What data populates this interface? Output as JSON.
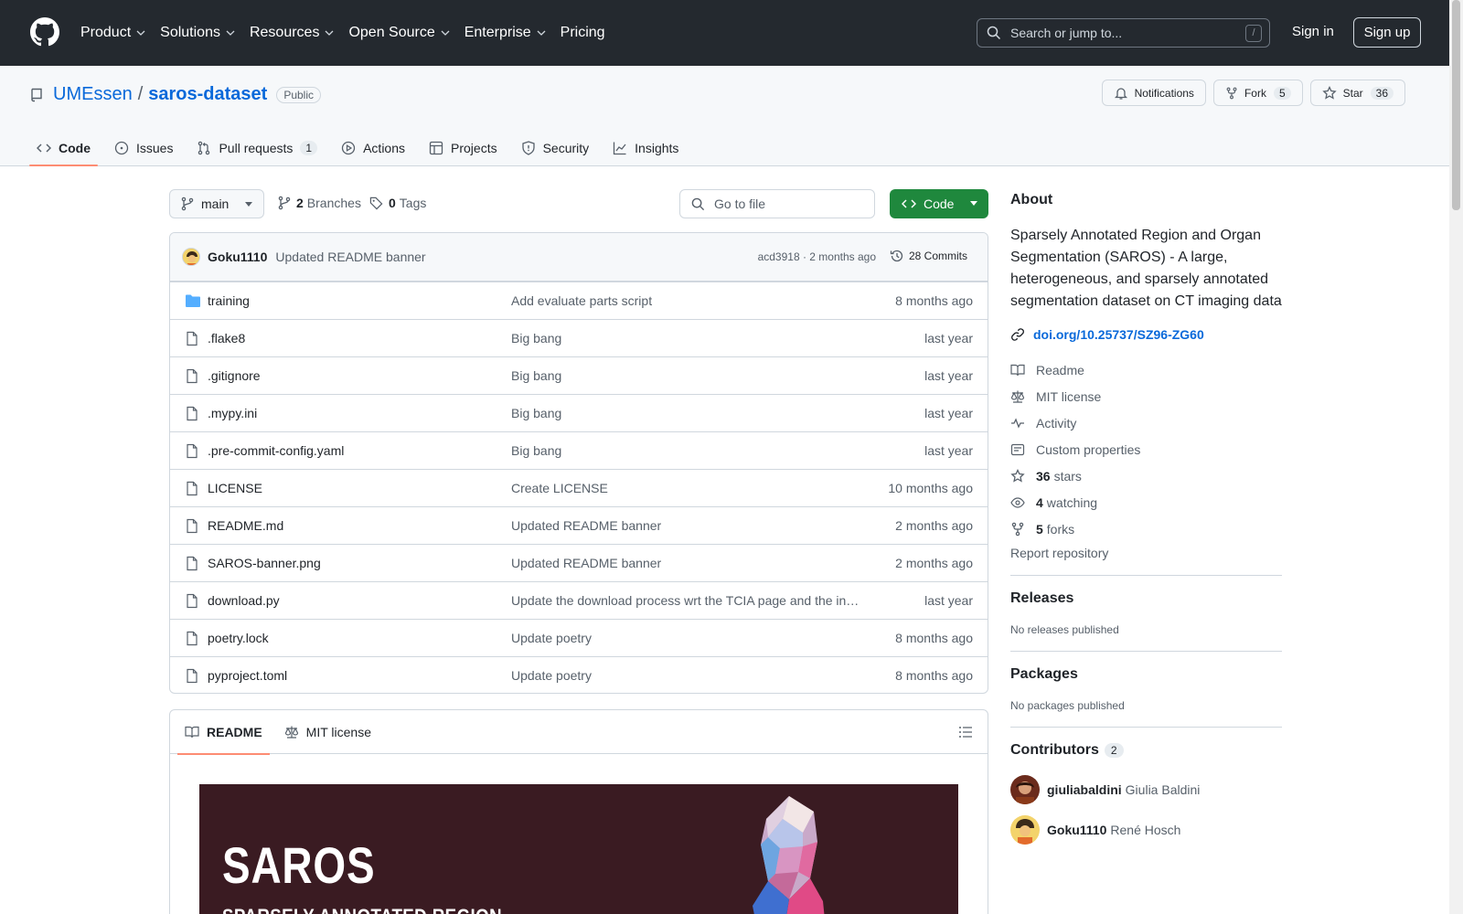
{
  "header": {
    "nav": [
      {
        "label": "Product",
        "has_menu": true
      },
      {
        "label": "Solutions",
        "has_menu": true
      },
      {
        "label": "Resources",
        "has_menu": true
      },
      {
        "label": "Open Source",
        "has_menu": true
      },
      {
        "label": "Enterprise",
        "has_menu": true
      },
      {
        "label": "Pricing",
        "has_menu": false
      }
    ],
    "search_placeholder": "Search or jump to...",
    "search_key": "/",
    "sign_in": "Sign in",
    "sign_up": "Sign up"
  },
  "repo": {
    "owner": "UMEssen",
    "separator": "/",
    "name": "saros-dataset",
    "visibility": "Public",
    "notifications_label": "Notifications",
    "fork_label": "Fork",
    "fork_count": "5",
    "star_label": "Star",
    "star_count": "36"
  },
  "tabs": [
    {
      "label": "Code",
      "icon": "code-icon",
      "active": true
    },
    {
      "label": "Issues",
      "icon": "issue-icon"
    },
    {
      "label": "Pull requests",
      "icon": "pull-request-icon",
      "count": "1"
    },
    {
      "label": "Actions",
      "icon": "play-icon"
    },
    {
      "label": "Projects",
      "icon": "table-icon"
    },
    {
      "label": "Security",
      "icon": "shield-icon"
    },
    {
      "label": "Insights",
      "icon": "graph-icon"
    }
  ],
  "toolbar": {
    "branch": "main",
    "branches_count": "2",
    "branches_label": "Branches",
    "tags_count": "0",
    "tags_label": "Tags",
    "goto_file_placeholder": "Go to file",
    "code_button": "Code"
  },
  "latest_commit": {
    "author": "Goku1110",
    "message": "Updated README banner",
    "sha_time": "acd3918 · 2 months ago",
    "commits_label": "28 Commits"
  },
  "files": [
    {
      "name": "training",
      "type": "folder",
      "message": "Add evaluate parts script",
      "date": "8 months ago"
    },
    {
      "name": ".flake8",
      "type": "file",
      "message": "Big bang",
      "date": "last year"
    },
    {
      "name": ".gitignore",
      "type": "file",
      "message": "Big bang",
      "date": "last year"
    },
    {
      "name": ".mypy.ini",
      "type": "file",
      "message": "Big bang",
      "date": "last year"
    },
    {
      "name": ".pre-commit-config.yaml",
      "type": "file",
      "message": "Big bang",
      "date": "last year"
    },
    {
      "name": "LICENSE",
      "type": "file",
      "message": "Create LICENSE",
      "date": "10 months ago"
    },
    {
      "name": "README.md",
      "type": "file",
      "message": "Updated README banner",
      "date": "2 months ago"
    },
    {
      "name": "SAROS-banner.png",
      "type": "file",
      "message": "Updated README banner",
      "date": "2 months ago"
    },
    {
      "name": "download.py",
      "type": "file",
      "message": "Update the download process wrt the TCIA page and the in…",
      "date": "last year"
    },
    {
      "name": "poetry.lock",
      "type": "file",
      "message": "Update poetry",
      "date": "8 months ago"
    },
    {
      "name": "pyproject.toml",
      "type": "file",
      "message": "Update poetry",
      "date": "8 months ago"
    }
  ],
  "readme": {
    "tab_readme": "README",
    "tab_license": "MIT license",
    "banner_title": "SAROS",
    "banner_subtitle": "SPARSELY ANNOTATED REGION"
  },
  "about": {
    "heading": "About",
    "description": "Sparsely Annotated Region and Organ Segmentation (SAROS) - A large, heterogeneous, and sparsely annotated segmentation dataset on CT imaging data",
    "doi": "doi.org/10.25737/SZ96-ZG60",
    "items": [
      {
        "icon": "book-icon",
        "bold": "",
        "label": "Readme"
      },
      {
        "icon": "law-icon",
        "bold": "",
        "label": "MIT license"
      },
      {
        "icon": "pulse-icon",
        "bold": "",
        "label": "Activity"
      },
      {
        "icon": "note-icon",
        "bold": "",
        "label": "Custom properties"
      },
      {
        "icon": "star-icon",
        "bold": "36",
        "label": "stars"
      },
      {
        "icon": "eye-icon",
        "bold": "4",
        "label": "watching"
      },
      {
        "icon": "fork-icon",
        "bold": "5",
        "label": "forks"
      }
    ],
    "report": "Report repository"
  },
  "releases": {
    "heading": "Releases",
    "note": "No releases published"
  },
  "packages": {
    "heading": "Packages",
    "note": "No packages published"
  },
  "contributors": {
    "heading": "Contributors",
    "count": "2",
    "people": [
      {
        "login": "giuliabaldini",
        "name": "Giulia Baldini"
      },
      {
        "login": "Goku1110",
        "name": "René Hosch"
      }
    ]
  }
}
